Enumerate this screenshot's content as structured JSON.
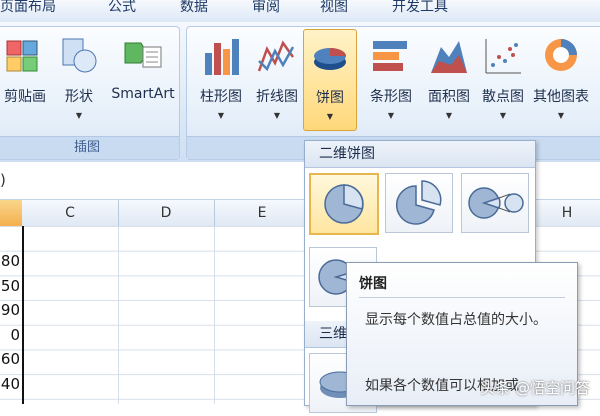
{
  "ribbon": {
    "tabs": [
      "页面布局",
      "公式",
      "数据",
      "审阅",
      "视图",
      "开发工具"
    ],
    "insert_group": {
      "buttons": [
        {
          "label": "剪贴画",
          "icon": "clip-art-icon"
        },
        {
          "label": "形状",
          "icon": "shapes-icon"
        },
        {
          "label": "SmartArt",
          "icon": "smartart-icon"
        }
      ],
      "label": "插图"
    },
    "chart_group": {
      "buttons": [
        {
          "label": "柱形图",
          "icon": "column-chart-icon"
        },
        {
          "label": "折线图",
          "icon": "line-chart-icon"
        },
        {
          "label": "饼图",
          "icon": "pie-chart-icon"
        },
        {
          "label": "条形图",
          "icon": "bar-chart-icon"
        },
        {
          "label": "面积图",
          "icon": "area-chart-icon"
        },
        {
          "label": "散点图",
          "icon": "scatter-chart-icon"
        },
        {
          "label": "其他图表",
          "icon": "other-charts-icon"
        }
      ]
    }
  },
  "grid": {
    "columns": [
      "C",
      "D",
      "E",
      "H"
    ],
    "row_values": [
      "80",
      "50",
      "90",
      "0",
      "60",
      "40"
    ]
  },
  "dropdown": {
    "header_2d": "二维饼图",
    "header_3d": "三维",
    "options_2d": [
      {
        "icon": "pie-icon"
      },
      {
        "icon": "exploded-pie-icon"
      },
      {
        "icon": "pie-of-pie-icon"
      },
      {
        "icon": "bar-of-pie-icon"
      }
    ]
  },
  "tooltip": {
    "title": "饼图",
    "body": "显示每个数值占总值的大小。",
    "more": "如果各个数值可以相加或"
  },
  "watermark": "头条 @悟空问答",
  "colors": {
    "accent": "#ffd87a",
    "ribbon": "#dbe7f6",
    "selection": "#f4b04e"
  }
}
